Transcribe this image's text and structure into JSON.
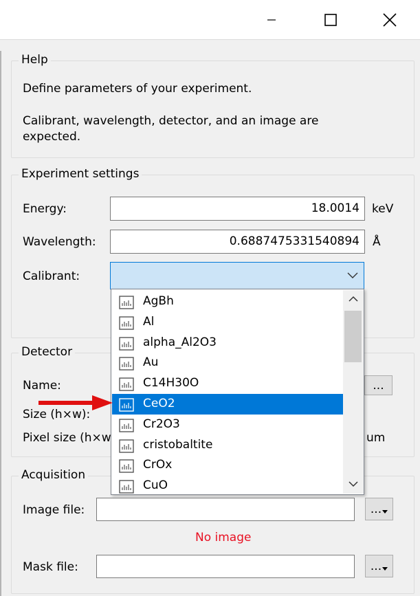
{
  "help": {
    "title": "Help",
    "line1": "Define parameters of your experiment.",
    "line2a": "Calibrant, wavelength, detector, and an image are",
    "line2b": "expected."
  },
  "experiment": {
    "title": "Experiment settings",
    "energy_label": "Energy:",
    "energy_value": "18.0014",
    "energy_unit": "keV",
    "wavelength_label": "Wavelength:",
    "wavelength_value": "0.6887475331540894",
    "wavelength_unit": "Å",
    "calibrant_label": "Calibrant:",
    "calibrant_value": ""
  },
  "calibrant_list": {
    "items": [
      "AgBh",
      "Al",
      "alpha_Al2O3",
      "Au",
      "C14H30O",
      "CeO2",
      "Cr2O3",
      "cristobaltite",
      "CrOx",
      "CuO"
    ],
    "selected": "CeO2"
  },
  "detector": {
    "title": "Detector",
    "name_label": "Name:",
    "size_label": "Size (h×w):",
    "pixel_label": "Pixel size (h×w):",
    "pixel_unit": "um",
    "browse_label": "..."
  },
  "acquisition": {
    "title": "Acquisition",
    "image_label": "Image file:",
    "no_image": "No image",
    "mask_label": "Mask file:",
    "browse_label": "..."
  },
  "colors": {
    "selection": "#0078d7",
    "no_image": "#e81123",
    "arrow": "#e01010"
  }
}
